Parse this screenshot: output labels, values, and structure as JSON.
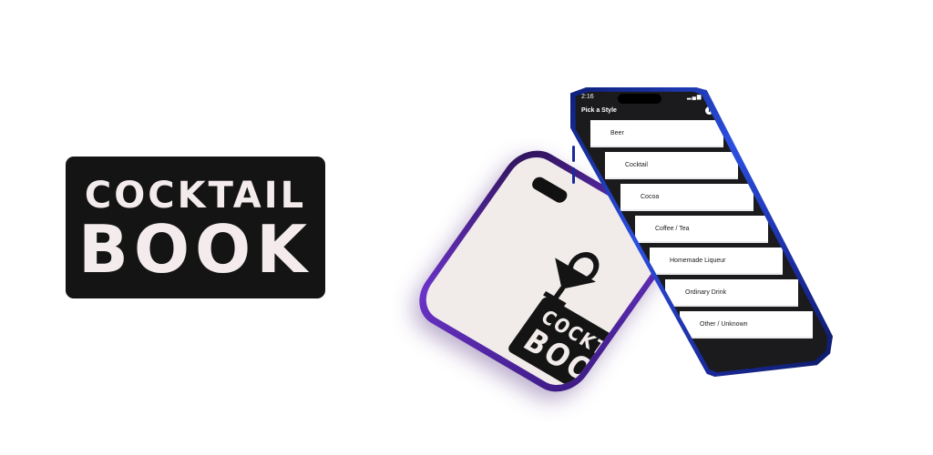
{
  "logo": {
    "line1": "COCKTAIL",
    "line2": "BOOK"
  },
  "back_phone": {
    "logo_line1": "COCKTAIL",
    "logo_line2": "BOOK",
    "icon": "cocktail-glass-icon"
  },
  "front_phone": {
    "status_time": "2:16",
    "nav_title": "Pick a Style",
    "info_icon": "info-icon",
    "info_glyph": "i",
    "list_items": [
      "Beer",
      "Cocktail",
      "Cocoa",
      "Coffee / Tea",
      "Homemade Liqueur",
      "Ordinary Drink",
      "Other / Unknown"
    ]
  },
  "colors": {
    "logo_bg": "#141414",
    "logo_text": "#f4ecec",
    "front_frame": "#2b4fe0",
    "back_frame": "#6b33c8"
  }
}
